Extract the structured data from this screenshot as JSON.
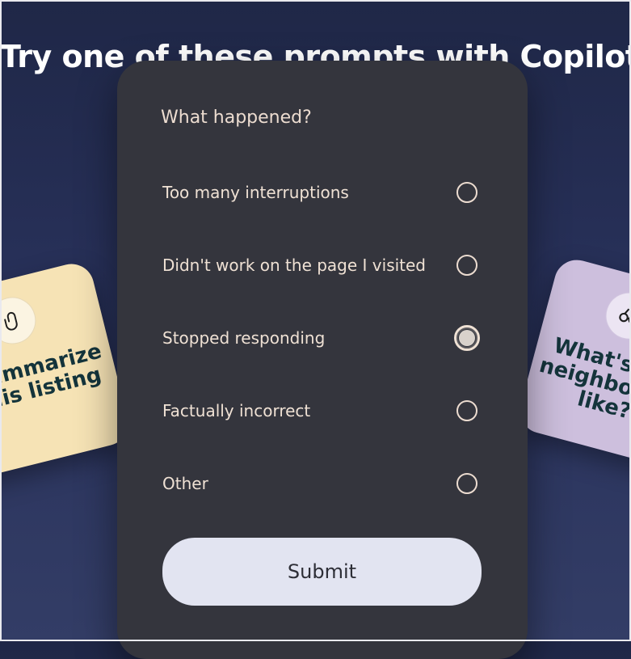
{
  "background": {
    "title": "Try one of these prompts with Copilot"
  },
  "cards": {
    "left": {
      "icon": "paperclip-icon",
      "text": "Summarize this listing"
    },
    "right": {
      "icon": "binoculars-icon",
      "text": "What's the neighborhood like?"
    }
  },
  "feedback": {
    "heading": "What happened?",
    "options": [
      {
        "label": "Too many interruptions",
        "selected": false
      },
      {
        "label": "Didn't work on the page I visited",
        "selected": false
      },
      {
        "label": "Stopped responding",
        "selected": true
      },
      {
        "label": "Factually incorrect",
        "selected": false
      },
      {
        "label": "Other",
        "selected": false
      }
    ],
    "submit_label": "Submit"
  },
  "colors": {
    "panel": "#34353d",
    "text": "#efe1d4",
    "submit_bg": "#e2e4f1",
    "card_left": "#f6e3b5",
    "card_right": "#cdbfdd"
  }
}
